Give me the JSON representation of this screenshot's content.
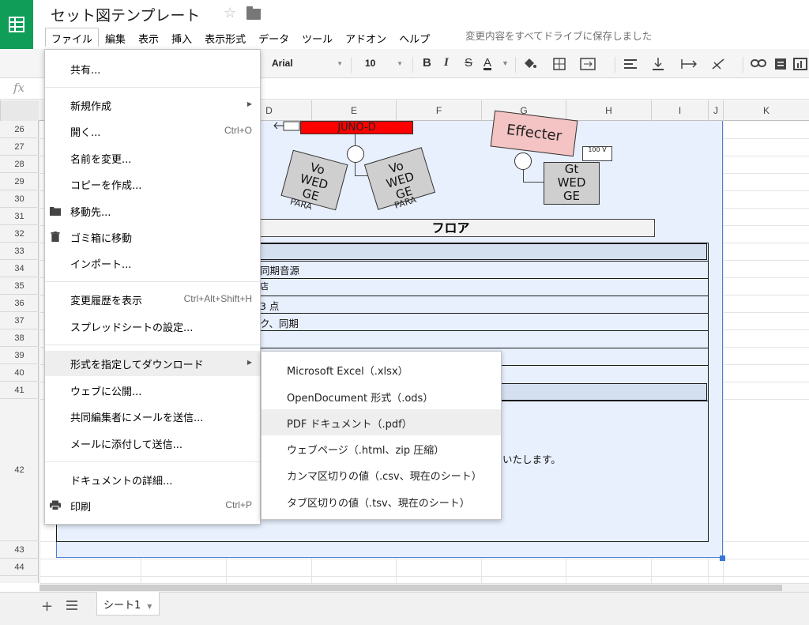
{
  "app": {
    "title": "セット図テンプレート",
    "save_status": "変更内容をすべてドライブに保存しました"
  },
  "menubar": [
    "ファイル",
    "編集",
    "表示",
    "挿入",
    "表示形式",
    "データ",
    "ツール",
    "アドオン",
    "ヘルプ"
  ],
  "toolbar": {
    "font": "Arial",
    "font_size": "10",
    "bold": "B",
    "italic": "I",
    "strike": "S",
    "text_color": "A"
  },
  "formula_bar": {
    "fx": "fx"
  },
  "columns": [
    "D",
    "E",
    "F",
    "G",
    "H",
    "I",
    "J",
    "K"
  ],
  "rows": [
    "26",
    "27",
    "28",
    "29",
    "30",
    "31",
    "32",
    "33",
    "34",
    "35",
    "36",
    "37",
    "38",
    "39",
    "40",
    "41",
    "42",
    "43",
    "44"
  ],
  "sheet": {
    "juno_label": "JUNO-D",
    "effecter_label": "Effecter",
    "wedge_vo": "Vo\nWED\nGE",
    "wedge_gt": "Gt\nWED\nGE",
    "para": "PARA",
    "box_label": "100\nV",
    "floor_label": "フロア",
    "row34": "同期音源",
    "row35": "店",
    "row36": "3 点",
    "row37": "ク、同期",
    "row42": "いたします。"
  },
  "file_menu": {
    "items": [
      {
        "label": "共有..."
      },
      {
        "label": "新規作成"
      },
      {
        "label": "開く...",
        "shortcut": "Ctrl+O"
      },
      {
        "label": "名前を変更..."
      },
      {
        "label": "コピーを作成..."
      },
      {
        "label": "移動先..."
      },
      {
        "label": "ゴミ箱に移動"
      },
      {
        "label": "インポート..."
      },
      {
        "label": "変更履歴を表示",
        "shortcut": "Ctrl+Alt+Shift+H"
      },
      {
        "label": "スプレッドシートの設定..."
      },
      {
        "label": "形式を指定してダウンロード"
      },
      {
        "label": "ウェブに公開..."
      },
      {
        "label": "共同編集者にメールを送信..."
      },
      {
        "label": "メールに添付して送信..."
      },
      {
        "label": "ドキュメントの詳細..."
      },
      {
        "label": "印刷",
        "shortcut": "Ctrl+P"
      }
    ]
  },
  "download_submenu": {
    "items": [
      {
        "label": "Microsoft Excel（.xlsx）"
      },
      {
        "label": "OpenDocument 形式（.ods）"
      },
      {
        "label": "PDF ドキュメント（.pdf）"
      },
      {
        "label": "ウェブページ（.html、zip 圧縮）"
      },
      {
        "label": "カンマ区切りの値（.csv、現在のシート）"
      },
      {
        "label": "タブ区切りの値（.tsv、現在のシート）"
      }
    ]
  },
  "sheet_tabs": [
    {
      "label": "シート1"
    }
  ],
  "colors": {
    "brand": "#0f9d58",
    "selection": "#e8f0fe",
    "juno": "#ff0000",
    "effecter": "#f4c3c3"
  }
}
